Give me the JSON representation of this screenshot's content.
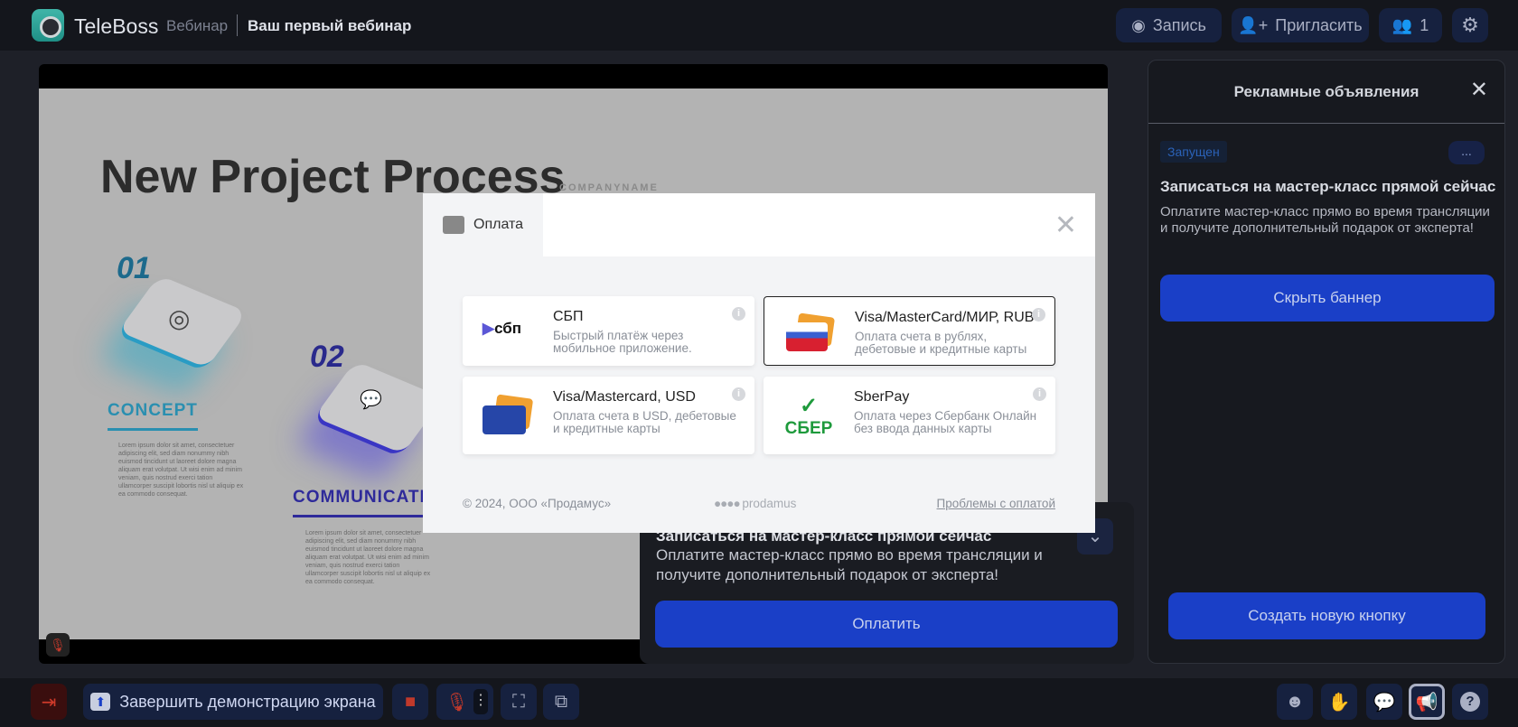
{
  "header": {
    "brand": "TeleBoss",
    "section": "Вебинар",
    "title": "Ваш первый вебинар",
    "record": "Запись",
    "invite": "Пригласить",
    "participants": "1"
  },
  "slide": {
    "title": "New Project Process",
    "company": "COMPANYNAME",
    "step1_num": "01",
    "step1": "CONCEPT",
    "step2_num": "02",
    "step2": "COMMUNICATI",
    "lorem": "Lorem ipsum dolor sit amet, consectetuer adipiscing elit, sed diam nonummy nibh euismod tincidunt ut laoreet dolore magna aliquam erat volutpat. Ut wisi enim ad minim veniam, quis nostrud exerci tation ullamcorper suscipit lobortis nisl ut aliquip ex ea commodo consequat."
  },
  "payment": {
    "tab": "Оплата",
    "methods": [
      {
        "title": "СБП",
        "desc": "Быстрый платёж через мобильное приложение.",
        "logo": "сбп"
      },
      {
        "title": "Visa/MasterCard/МИР, RUB",
        "desc": "Оплата счета в рублях, дебетовые и кредитные карты"
      },
      {
        "title": "Visa/Mastercard, USD",
        "desc": "Оплата счета в USD, дебетовые и кредитные карты"
      },
      {
        "title": "SberPay",
        "desc": "Оплата через Сбербанк Онлайн без ввода данных карты",
        "logo": "СБЕР"
      }
    ],
    "copyright": "© 2024, ООО «Продамус»",
    "provider": "prodamus",
    "problems": "Проблемы с оплатой"
  },
  "banner": {
    "title": "Записаться на мастер-класс прямой сейчас",
    "text": "Оплатите мастер-класс прямо во время трансляции и получите дополнительный подарок от эксперта!",
    "pay": "Оплатить"
  },
  "panel": {
    "title": "Рекламные объявления",
    "status": "Запущен",
    "more": "...",
    "ad_title": "Записаться на мастер-класс прямой сейчас",
    "ad_text": "Оплатите мастер-класс прямо во время трансляции и получите дополнительный подарок от эксперта!",
    "hide": "Скрыть баннер",
    "create": "Создать новую кнопку"
  },
  "toolbar": {
    "stop_share": "Завершить демонстрацию экрана"
  },
  "colors": {
    "accent": "#1a3fc7",
    "danger": "#c0392b"
  }
}
